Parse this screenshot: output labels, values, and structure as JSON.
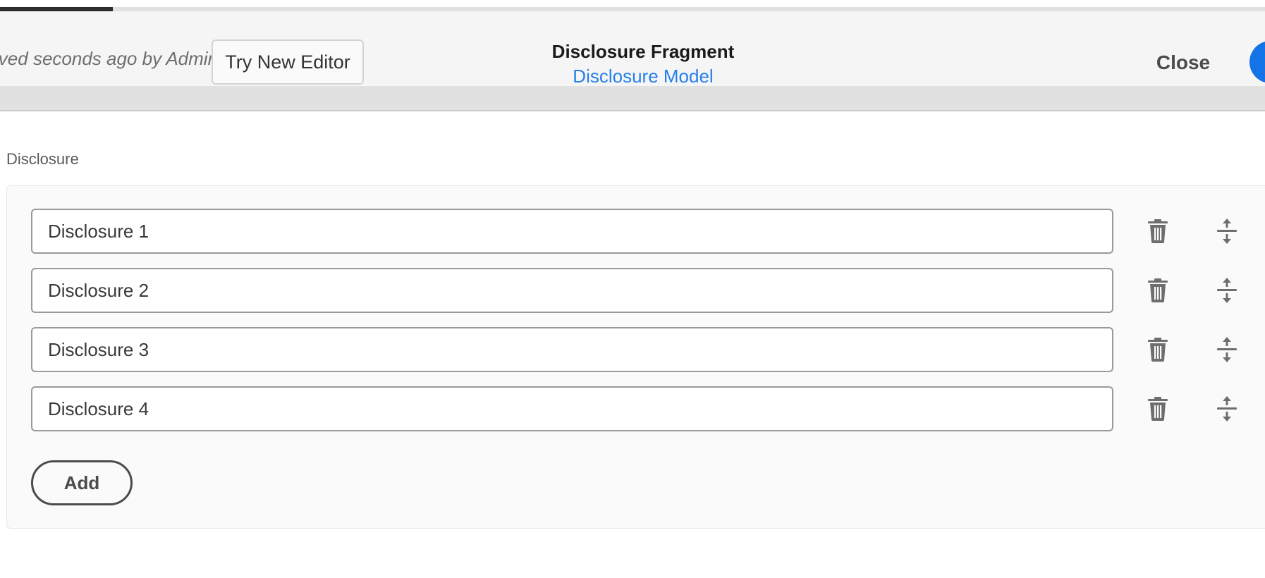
{
  "progress": {
    "value": 0.089
  },
  "header": {
    "modified_text": "Saved seconds ago by Administrator",
    "try_new_editor_label": "Try New Editor",
    "fragment_title": "Disclosure Fragment",
    "model_link": "Disclosure Model",
    "close_label": "Close"
  },
  "section": {
    "label": "Disclosure",
    "items": [
      {
        "value": "Disclosure 1",
        "delete_icon": "trash-icon",
        "reorder_icon": "drag-handle-icon"
      },
      {
        "value": "Disclosure 2",
        "delete_icon": "trash-icon",
        "reorder_icon": "drag-handle-icon"
      },
      {
        "value": "Disclosure 3",
        "delete_icon": "trash-icon",
        "reorder_icon": "drag-handle-icon"
      },
      {
        "value": "Disclosure 4",
        "delete_icon": "trash-icon",
        "reorder_icon": "drag-handle-icon"
      }
    ],
    "add_label": "Add"
  },
  "colors": {
    "accent": "#2680eb",
    "primary_button": "#1473e6",
    "icon": "#6e6e6e"
  }
}
